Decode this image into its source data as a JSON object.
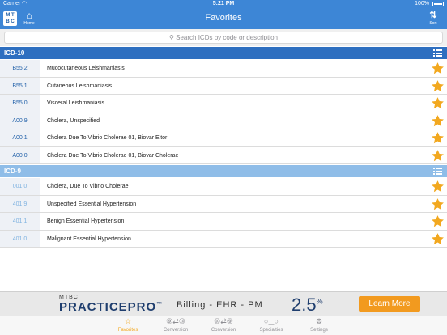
{
  "statusbar": {
    "carrier": "Carrier",
    "time": "5:21 PM",
    "battery": "100%"
  },
  "navbar": {
    "logo": "MTBC",
    "home_label": "Home",
    "title": "Favorites",
    "sort_label": "Sort"
  },
  "search": {
    "placeholder": "Search ICDs by code or description"
  },
  "colors": {
    "accent": "#3d86d6",
    "icd10_header": "#2e6fc0",
    "icd9_header": "#8fbde8",
    "star": "#f2a81f",
    "icd10_code": "#1f5fa8",
    "icd9_code": "#7fb2e0"
  },
  "icd10": {
    "label": "ICD-10",
    "rows": [
      {
        "code": "B55.2",
        "description": "Mucocutaneous Leishmaniasis"
      },
      {
        "code": "B55.1",
        "description": "Cutaneous Leishmaniasis"
      },
      {
        "code": "B55.0",
        "description": "Visceral Leishmaniasis"
      },
      {
        "code": "A00.9",
        "description": "Cholera, Unspecified"
      },
      {
        "code": "A00.1",
        "description": "Cholera Due To Vibrio Cholerae 01, Biovar Eltor"
      },
      {
        "code": "A00.0",
        "description": "Cholera Due To Vibrio Cholerae 01, Biovar Cholerae"
      }
    ]
  },
  "icd9": {
    "label": "ICD-9",
    "rows": [
      {
        "code": "001.0",
        "description": "Cholera, Due To Vibrio Cholerae"
      },
      {
        "code": "401.9",
        "description": "Unspecified Essential Hypertension"
      },
      {
        "code": "401.1",
        "description": "Benign Essential Hypertension"
      },
      {
        "code": "401.0",
        "description": "Malignant Essential Hypertension"
      }
    ]
  },
  "ad": {
    "mtbc": "MTBC",
    "brand": "PRACTICEPRO",
    "tm": "™",
    "tagline": "Billing - EHR - PM",
    "percent": "2.5",
    "percent_sign": "%",
    "cta": "Learn More"
  },
  "tabbar": [
    {
      "label": "Favorites",
      "icon": "star-outline-icon",
      "glyph": "☆",
      "active": true
    },
    {
      "label": "Conversion",
      "icon": "icd9-to-icd10-icon",
      "glyph": "⑨⇄⑩",
      "active": false
    },
    {
      "label": "Conversion",
      "icon": "icd10-to-icd9-icon",
      "glyph": "⑩⇄⑨",
      "active": false
    },
    {
      "label": "Specialties",
      "icon": "glasses-icon",
      "glyph": "○‿○",
      "active": false
    },
    {
      "label": "Settings",
      "icon": "gear-icon",
      "glyph": "⚙",
      "active": false
    }
  ]
}
